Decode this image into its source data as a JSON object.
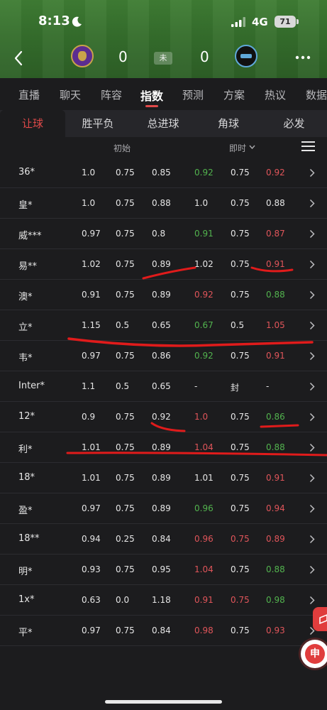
{
  "status_bar": {
    "time": "8:13",
    "network": "4G",
    "battery": "71"
  },
  "match": {
    "home_score": "0",
    "away_score": "0",
    "status": "未"
  },
  "main_tabs": [
    {
      "label": "直播",
      "active": false
    },
    {
      "label": "聊天",
      "active": false
    },
    {
      "label": "阵容",
      "active": false
    },
    {
      "label": "指数",
      "active": true
    },
    {
      "label": "预测",
      "active": false
    },
    {
      "label": "方案",
      "active": false
    },
    {
      "label": "热议",
      "active": false
    },
    {
      "label": "数据",
      "active": false
    }
  ],
  "sub_tabs": [
    {
      "label": "让球",
      "active": true
    },
    {
      "label": "胜平负",
      "active": false
    },
    {
      "label": "总进球",
      "active": false
    },
    {
      "label": "角球",
      "active": false
    },
    {
      "label": "必发",
      "active": false
    }
  ],
  "columns": {
    "initial": "初始",
    "live": "即时"
  },
  "colors": {
    "accent": "#e14a4a",
    "up": "#e0555a",
    "down": "#52b34e",
    "background": "#1c1c1e"
  },
  "rows": [
    {
      "company": "36*",
      "cells": [
        "1.0",
        "0.75",
        "0.85",
        "0.92",
        "0.75",
        "0.92"
      ],
      "trend": [
        "",
        "",
        "",
        "down",
        "",
        "up"
      ]
    },
    {
      "company": "皇*",
      "cells": [
        "1.0",
        "0.75",
        "0.88",
        "1.0",
        "0.75",
        "0.88"
      ],
      "trend": [
        "",
        "",
        "",
        "",
        "",
        ""
      ]
    },
    {
      "company": "威***",
      "cells": [
        "0.97",
        "0.75",
        "0.8",
        "0.91",
        "0.75",
        "0.87"
      ],
      "trend": [
        "",
        "",
        "",
        "down",
        "",
        "up"
      ]
    },
    {
      "company": "易**",
      "cells": [
        "1.02",
        "0.75",
        "0.89",
        "1.02",
        "0.75",
        "0.91"
      ],
      "trend": [
        "",
        "",
        "",
        "",
        "",
        "up"
      ]
    },
    {
      "company": "澳*",
      "cells": [
        "0.91",
        "0.75",
        "0.89",
        "0.92",
        "0.75",
        "0.88"
      ],
      "trend": [
        "",
        "",
        "",
        "up",
        "",
        "down"
      ]
    },
    {
      "company": "立*",
      "cells": [
        "1.15",
        "0.5",
        "0.65",
        "0.67",
        "0.5",
        "1.05"
      ],
      "trend": [
        "",
        "",
        "",
        "down",
        "",
        "up"
      ]
    },
    {
      "company": "韦*",
      "cells": [
        "0.97",
        "0.75",
        "0.86",
        "0.92",
        "0.75",
        "0.91"
      ],
      "trend": [
        "",
        "",
        "",
        "down",
        "",
        "up"
      ]
    },
    {
      "company": "Inter*",
      "cells": [
        "1.1",
        "0.5",
        "0.65",
        "-",
        "封",
        "-"
      ],
      "trend": [
        "",
        "",
        "",
        "",
        "",
        ""
      ]
    },
    {
      "company": "12*",
      "cells": [
        "0.9",
        "0.75",
        "0.92",
        "1.0",
        "0.75",
        "0.86"
      ],
      "trend": [
        "",
        "",
        "",
        "up",
        "",
        "down"
      ]
    },
    {
      "company": "利*",
      "cells": [
        "1.01",
        "0.75",
        "0.89",
        "1.04",
        "0.75",
        "0.88"
      ],
      "trend": [
        "",
        "",
        "",
        "up",
        "",
        "down"
      ]
    },
    {
      "company": "18*",
      "cells": [
        "1.01",
        "0.75",
        "0.89",
        "1.01",
        "0.75",
        "0.91"
      ],
      "trend": [
        "",
        "",
        "",
        "",
        "",
        "up"
      ]
    },
    {
      "company": "盈*",
      "cells": [
        "0.97",
        "0.75",
        "0.89",
        "0.96",
        "0.75",
        "0.94"
      ],
      "trend": [
        "",
        "",
        "",
        "down",
        "",
        "up"
      ]
    },
    {
      "company": "18**",
      "cells": [
        "0.94",
        "0.25",
        "0.84",
        "0.96",
        "0.75",
        "0.89"
      ],
      "trend": [
        "",
        "",
        "",
        "up",
        "up",
        "up"
      ]
    },
    {
      "company": "明*",
      "cells": [
        "0.93",
        "0.75",
        "0.95",
        "1.04",
        "0.75",
        "0.88"
      ],
      "trend": [
        "",
        "",
        "",
        "up",
        "",
        "down"
      ]
    },
    {
      "company": "1x*",
      "cells": [
        "0.63",
        "0.0",
        "1.18",
        "0.91",
        "0.75",
        "0.98"
      ],
      "trend": [
        "",
        "",
        "",
        "up",
        "up",
        "down"
      ]
    },
    {
      "company": "平*",
      "cells": [
        "0.97",
        "0.75",
        "0.84",
        "0.98",
        "0.75",
        "0.93"
      ],
      "trend": [
        "",
        "",
        "",
        "up",
        "",
        "up"
      ]
    }
  ],
  "float_button": {
    "label": "申"
  }
}
